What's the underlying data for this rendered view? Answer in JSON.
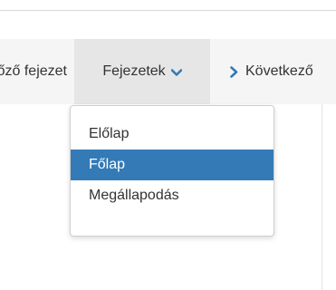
{
  "nav": {
    "prev_label": "Előző fejezet",
    "chapters_label": "Fejezetek",
    "next_label": "Következő"
  },
  "dropdown": {
    "items": [
      {
        "label": "Előlap",
        "active": false
      },
      {
        "label": "Főlap",
        "active": true
      },
      {
        "label": "Megállapodás",
        "active": false
      }
    ]
  },
  "colors": {
    "accent": "#337ab7",
    "nav_background": "#f5f5f5",
    "active_nav_background": "#e6e6e6"
  },
  "icons": {
    "dropdown": "chevron-down-icon",
    "next": "chevron-right-icon"
  }
}
